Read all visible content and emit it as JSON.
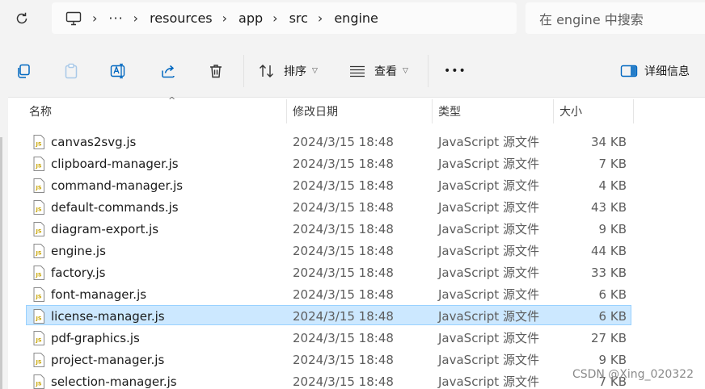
{
  "breadcrumb": {
    "more": "···",
    "items": [
      "resources",
      "app",
      "src",
      "engine"
    ]
  },
  "search": {
    "placeholder": "在 engine 中搜索"
  },
  "toolbar": {
    "sort_label": "排序",
    "view_label": "查看",
    "more_label": "•••",
    "details_label": "详细信息"
  },
  "columns": {
    "name": "名称",
    "date": "修改日期",
    "type": "类型",
    "size": "大小"
  },
  "files": [
    {
      "name": "canvas2svg.js",
      "date": "2024/3/15 18:48",
      "type": "JavaScript 源文件",
      "size": "34 KB"
    },
    {
      "name": "clipboard-manager.js",
      "date": "2024/3/15 18:48",
      "type": "JavaScript 源文件",
      "size": "7 KB"
    },
    {
      "name": "command-manager.js",
      "date": "2024/3/15 18:48",
      "type": "JavaScript 源文件",
      "size": "4 KB"
    },
    {
      "name": "default-commands.js",
      "date": "2024/3/15 18:48",
      "type": "JavaScript 源文件",
      "size": "43 KB"
    },
    {
      "name": "diagram-export.js",
      "date": "2024/3/15 18:48",
      "type": "JavaScript 源文件",
      "size": "9 KB"
    },
    {
      "name": "engine.js",
      "date": "2024/3/15 18:48",
      "type": "JavaScript 源文件",
      "size": "44 KB"
    },
    {
      "name": "factory.js",
      "date": "2024/3/15 18:48",
      "type": "JavaScript 源文件",
      "size": "33 KB"
    },
    {
      "name": "font-manager.js",
      "date": "2024/3/15 18:48",
      "type": "JavaScript 源文件",
      "size": "6 KB"
    },
    {
      "name": "license-manager.js",
      "date": "2024/3/15 18:48",
      "type": "JavaScript 源文件",
      "size": "6 KB"
    },
    {
      "name": "pdf-graphics.js",
      "date": "2024/3/15 18:48",
      "type": "JavaScript 源文件",
      "size": "27 KB"
    },
    {
      "name": "project-manager.js",
      "date": "2024/3/15 18:48",
      "type": "JavaScript 源文件",
      "size": "9 KB"
    },
    {
      "name": "selection-manager.js",
      "date": "2024/3/15 18:48",
      "type": "JavaScript 源文件",
      "size": "7 KB"
    }
  ],
  "selected_index": 8,
  "file_icon_text": "JS",
  "watermark": "CSDN @Xing_020322",
  "colors": {
    "selection_bg": "#cce8ff",
    "selection_border": "#99d1ff",
    "accent": "#0067c0",
    "js_icon": "#c8a400"
  }
}
